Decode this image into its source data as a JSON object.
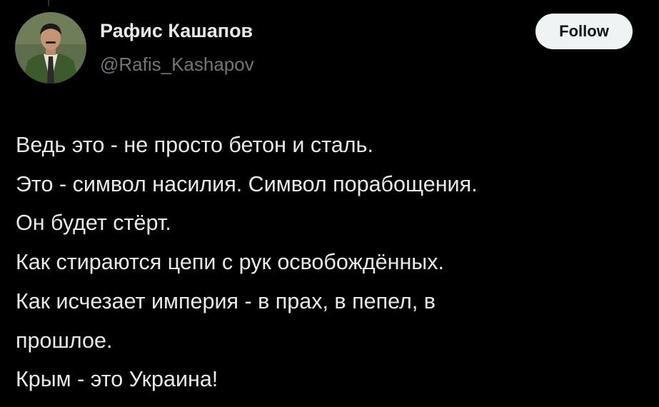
{
  "author": {
    "display_name": "Рафис Кашапов",
    "handle": "@Rafis_Kashapov",
    "avatar": "profile-photo"
  },
  "follow_button": {
    "label": "Follow"
  },
  "tweet": {
    "lines": [
      "Ведь это - не просто бетон и сталь.",
      "Это - символ насилия. Символ порабощения.",
      "Он будет стёрт.",
      "Как стираются цепи с рук освобождённых.",
      "Как исчезает империя - в прах, в пепел, в",
      "прошлое.",
      "Крым - это Украина!"
    ]
  },
  "colors": {
    "background": "#000000",
    "text_primary": "#e7e9ea",
    "text_secondary": "#71767b",
    "button_bg": "#eff3f4",
    "button_text": "#0f1419"
  }
}
